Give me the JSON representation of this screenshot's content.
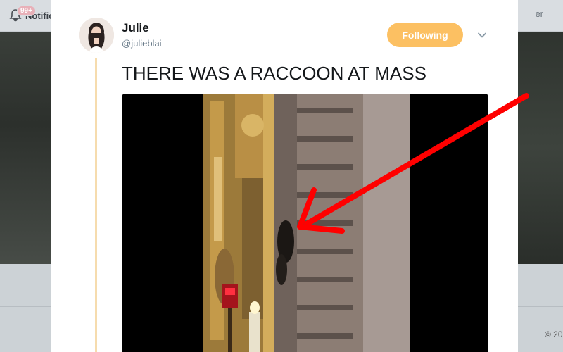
{
  "background": {
    "notifications_badge": "99+",
    "notifications_label": "Notific",
    "search_fragment": "er",
    "copyright": "© 20"
  },
  "tweet": {
    "author_name": "Julie",
    "author_handle": "@julieblai",
    "follow_button_label": "Following",
    "text": "THERE WAS A RACCOON AT MASS"
  },
  "colors": {
    "follow_button": "#fcc062",
    "thread_line": "#f6dcae",
    "annotation_arrow": "#ff0000"
  },
  "icons": {
    "notifications": "bell-icon",
    "menu": "chevron-down-icon"
  }
}
